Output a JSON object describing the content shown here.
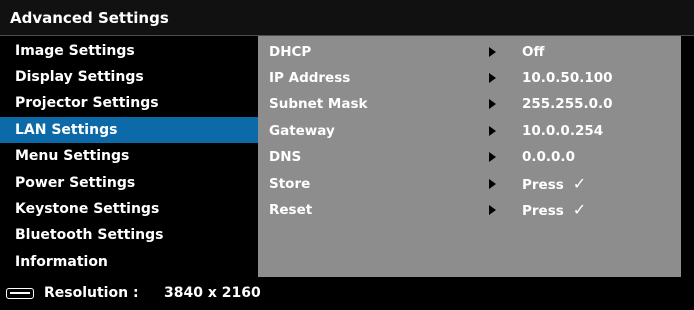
{
  "title": "Advanced Settings",
  "sidebar": {
    "items": [
      {
        "label": "Image Settings"
      },
      {
        "label": "Display Settings"
      },
      {
        "label": "Projector Settings"
      },
      {
        "label": "LAN Settings",
        "selected": true
      },
      {
        "label": "Menu Settings"
      },
      {
        "label": "Power Settings"
      },
      {
        "label": "Keystone Settings"
      },
      {
        "label": "Bluetooth Settings"
      },
      {
        "label": "Information"
      }
    ]
  },
  "lan": {
    "rows": [
      {
        "label": "DHCP",
        "value": "Off"
      },
      {
        "label": "IP Address",
        "value": "10.0.50.100"
      },
      {
        "label": "Subnet Mask",
        "value": "255.255.0.0"
      },
      {
        "label": "Gateway",
        "value": "10.0.0.254"
      },
      {
        "label": "DNS",
        "value": "0.0.0.0"
      },
      {
        "label": "Store",
        "value": "Press",
        "icon": "check-icon"
      },
      {
        "label": "Reset",
        "value": "Press",
        "icon": "check-icon"
      }
    ]
  },
  "status": {
    "icon": "input-source-icon",
    "resolution_label": "Resolution :",
    "resolution_value": "3840 x 2160"
  },
  "colors": {
    "selected": "#0b6aa7",
    "panel": "#8d8d8d",
    "background": "#000000"
  }
}
